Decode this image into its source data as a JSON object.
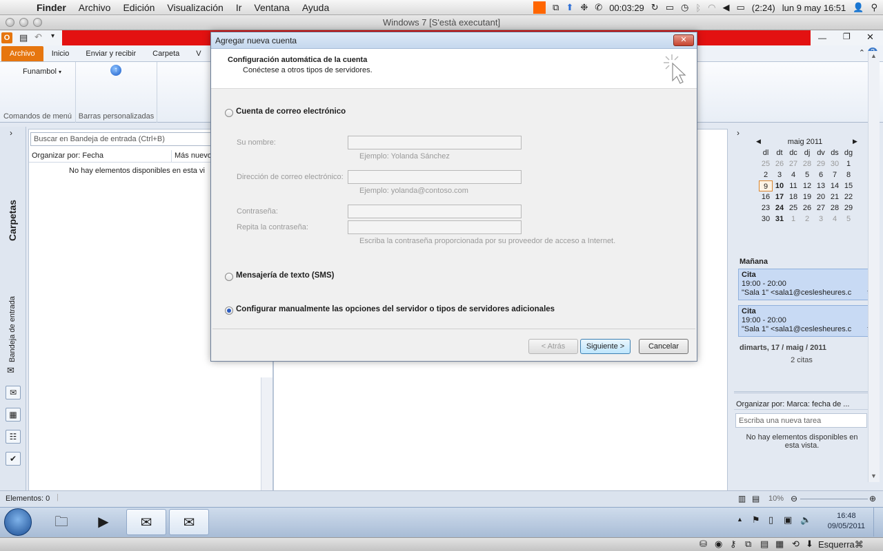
{
  "mac_menubar": {
    "app": "Finder",
    "menus": [
      "Archivo",
      "Edición",
      "Visualización",
      "Ir",
      "Ventana",
      "Ayuda"
    ],
    "timer": "00:03:29",
    "battery": "(2:24)",
    "datetime": "lun 9 may  16:51"
  },
  "vm_window": {
    "title": "Windows 7 [S'està executant]"
  },
  "ribbon": {
    "tabs": [
      "Archivo",
      "Inicio",
      "Enviar y recibir",
      "Carpeta",
      "V"
    ],
    "funambol_label": "Funambol",
    "group1_label": "Comandos de menú",
    "group2_label": "Barras personalizadas"
  },
  "nav": {
    "folders_label": "Carpetas",
    "inbox_label": "Bandeja de entrada"
  },
  "list": {
    "search_placeholder": "Buscar en Bandeja de entrada (Ctrl+B)",
    "sort_label": "Organizar por: Fecha",
    "sort_order": "Más nuevo",
    "empty_message": "No hay elementos disponibles en esta vi"
  },
  "calendar": {
    "month": "maig 2011",
    "weekdays": [
      "dl",
      "dt",
      "dc",
      "dj",
      "dv",
      "ds",
      "dg"
    ],
    "weeks": [
      [
        [
          "25",
          "dim"
        ],
        [
          "26",
          "dim"
        ],
        [
          "27",
          "dim"
        ],
        [
          "28",
          "dim"
        ],
        [
          "29",
          "dim"
        ],
        [
          "30",
          "dim"
        ],
        [
          "1",
          ""
        ]
      ],
      [
        [
          "2",
          ""
        ],
        [
          "3",
          ""
        ],
        [
          "4",
          ""
        ],
        [
          "5",
          ""
        ],
        [
          "6",
          ""
        ],
        [
          "7",
          ""
        ],
        [
          "8",
          ""
        ]
      ],
      [
        [
          "9",
          "today"
        ],
        [
          "10",
          "bold"
        ],
        [
          "11",
          ""
        ],
        [
          "12",
          ""
        ],
        [
          "13",
          ""
        ],
        [
          "14",
          ""
        ],
        [
          "15",
          ""
        ]
      ],
      [
        [
          "16",
          ""
        ],
        [
          "17",
          "bold"
        ],
        [
          "18",
          ""
        ],
        [
          "19",
          ""
        ],
        [
          "20",
          ""
        ],
        [
          "21",
          ""
        ],
        [
          "22",
          ""
        ]
      ],
      [
        [
          "23",
          ""
        ],
        [
          "24",
          "bold"
        ],
        [
          "25",
          ""
        ],
        [
          "26",
          ""
        ],
        [
          "27",
          ""
        ],
        [
          "28",
          ""
        ],
        [
          "29",
          ""
        ]
      ],
      [
        [
          "30",
          ""
        ],
        [
          "31",
          "bold"
        ],
        [
          "1",
          "dim"
        ],
        [
          "2",
          "dim"
        ],
        [
          "3",
          "dim"
        ],
        [
          "4",
          "dim"
        ],
        [
          "5",
          "dim"
        ]
      ]
    ],
    "tomorrow_label": "Mañana",
    "appointments": [
      {
        "title": "Cita",
        "time": "19:00 - 20:00",
        "location": "\"Sala 1\" <sala1@cesleshe­ures.c"
      },
      {
        "title": "Cita",
        "time": "19:00 - 20:00",
        "location": "\"Sala 1\" <sala1@cesleshe­ures.c"
      }
    ],
    "next_date": "dimarts, 17 / maig / 2011",
    "next_count": "2 citas"
  },
  "tasks": {
    "sort_label": "Organizar por: Marca: fecha de ...",
    "new_task_placeholder": "Escriba una nueva tarea",
    "empty_message": "No hay elementos disponibles en esta vista."
  },
  "statusbar": {
    "items": "Elementos: 0",
    "zoom": "10%"
  },
  "taskbar": {
    "time": "16:48",
    "date": "09/05/2011"
  },
  "vm_bottom": {
    "keyboard": "Esquerra⌘"
  },
  "dialog": {
    "title": "Agregar nueva cuenta",
    "close": "✕",
    "heading": "Configuración automática de la cuenta",
    "subheading": "Conéctese a otros tipos de servidores.",
    "option_email": "Cuenta de correo electrónico",
    "name_label": "Su nombre:",
    "name_hint": "Ejemplo: Yolanda Sánchez",
    "email_label": "Dirección de correo electrónico:",
    "email_hint": "Ejemplo: yolanda@contoso.com",
    "password_label": "Contraseña:",
    "repeat_password_label": "Repita la contraseña:",
    "password_hint": "Escriba la contraseña proporcionada por su proveedor de acceso a Internet.",
    "option_sms": "Mensajería de texto (SMS)",
    "option_manual": "Configurar manualmente las opciones del servidor o tipos de servidores adicionales",
    "selected_option": "manual",
    "back_button": "< Atrás",
    "next_button": "Siguiente >",
    "cancel_button": "Cancelar"
  }
}
